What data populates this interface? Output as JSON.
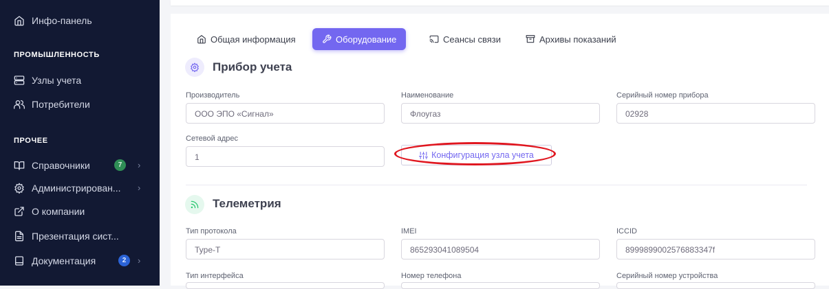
{
  "sidebar": {
    "items": [
      {
        "label": "Инфо-панель",
        "icon": "home-icon"
      },
      {
        "label": "Узлы учета",
        "icon": "server-icon"
      },
      {
        "label": "Потребители",
        "icon": "users-icon"
      },
      {
        "label": "Справочники",
        "icon": "book-icon",
        "badge": "7"
      },
      {
        "label": "Администрирован...",
        "icon": "gear-icon"
      },
      {
        "label": "О компании",
        "icon": "external-link-icon"
      },
      {
        "label": "Презентация сист...",
        "icon": "file-text-icon"
      },
      {
        "label": "Документация",
        "icon": "document-icon",
        "badge": "2"
      }
    ],
    "sections": {
      "industry": "ПРОМЫШЛЕННОСТЬ",
      "other": "ПРОЧЕЕ"
    },
    "chevron": "›"
  },
  "tabs": [
    {
      "label": "Общая информация",
      "icon": "home-icon",
      "active": false
    },
    {
      "label": "Оборудование",
      "icon": "tool-icon",
      "active": true
    },
    {
      "label": "Сеансы связи",
      "icon": "cast-icon",
      "active": false
    },
    {
      "label": "Архивы показаний",
      "icon": "archive-icon",
      "active": false
    }
  ],
  "device": {
    "title": "Прибор учета",
    "manufacturer_label": "Производитель",
    "manufacturer_value": "ООО ЭПО «Сигнал»",
    "name_label": "Наименование",
    "name_value": "Флоугаз",
    "serial_label": "Серийный номер прибора",
    "serial_value": "02928",
    "net_address_label": "Сетевой адрес",
    "net_address_value": "1",
    "config_button_label": "Конфигурация узла учета"
  },
  "telemetry": {
    "title": "Телеметрия",
    "protocol_label": "Тип протокола",
    "protocol_value": "Type-T",
    "imei_label": "IMEI",
    "imei_value": "865293041089504",
    "iccid_label": "ICCID",
    "iccid_value": "8999899002576883347f",
    "interface_label": "Тип интерфейса",
    "phone_label": "Номер телефона",
    "device_serial_label": "Серийный номер устройства"
  },
  "colors": {
    "sidebar_bg": "#121933",
    "accent": "#7367f0",
    "badge_green": "#2f8e56",
    "badge_blue": "#2b63d6",
    "annotation_red": "#e0161f",
    "telemetry_green": "#28c76f"
  }
}
